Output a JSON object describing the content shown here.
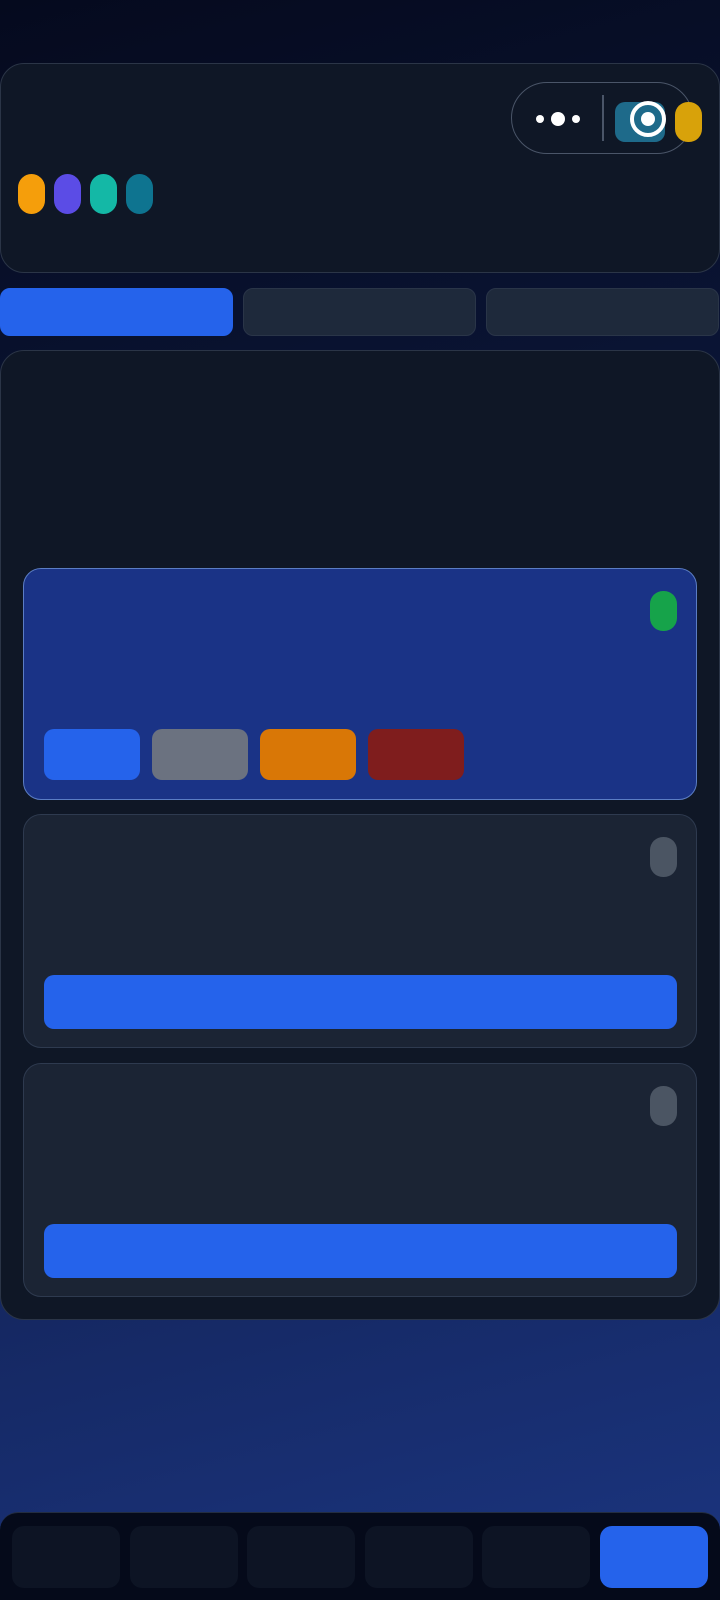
{
  "header": {
    "capsule_icons": [
      "more-icon",
      "target-icon"
    ],
    "color_dots": [
      "#f59e0b",
      "#5b4ce6",
      "#14b8a6",
      "#0e7490"
    ],
    "side_pill_color": "#d8a20a"
  },
  "tabs": [
    {
      "active": true
    },
    {
      "active": false
    },
    {
      "active": false
    }
  ],
  "cards": [
    {
      "selected": true,
      "status_color": "#16a34a",
      "actions": [
        {
          "color": "#2563eb"
        },
        {
          "color": "#6b7280"
        },
        {
          "color": "#d97706"
        },
        {
          "color": "#7f1d1d"
        }
      ]
    },
    {
      "selected": false,
      "status_color": "#4b5563",
      "button_color": "#2563eb"
    },
    {
      "selected": false,
      "status_color": "#4b5563",
      "button_color": "#2563eb"
    }
  ],
  "bottom_nav": {
    "item_count": 6,
    "active_index": 5
  }
}
